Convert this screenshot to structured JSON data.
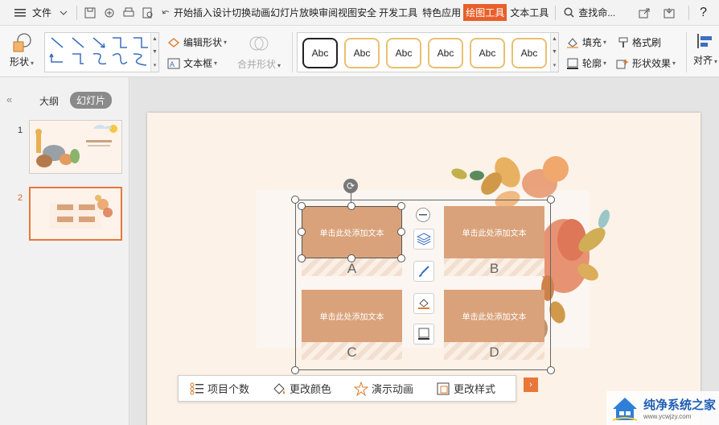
{
  "menubar": {
    "file": "文件",
    "tabs": [
      "开始",
      "插入",
      "设计",
      "切换",
      "动画",
      "幻灯片放映",
      "审阅",
      "视图",
      "安全",
      "开发工具",
      "特色应用",
      "绘图工具",
      "文本工具"
    ],
    "search": "查找命..."
  },
  "ribbon": {
    "shape": "形状",
    "edit_shape": "编辑形状",
    "text_box": "文本框",
    "merge_shape": "合并形状",
    "style_samples": [
      "Abc",
      "Abc",
      "Abc",
      "Abc",
      "Abc",
      "Abc"
    ],
    "fill": "填充",
    "format_painter": "格式刷",
    "outline": "轮廓",
    "shape_effect": "形状效果",
    "align": "对齐"
  },
  "leftpanel": {
    "tab_outline": "大纲",
    "tab_slides": "幻灯片",
    "thumbs": [
      "1",
      "2"
    ]
  },
  "slide": {
    "boxes": [
      {
        "text": "单击此处添加文本",
        "letter": "A"
      },
      {
        "text": "单击此处添加文本",
        "letter": "B"
      },
      {
        "text": "单击此处添加文本",
        "letter": "C"
      },
      {
        "text": "单击此处添加文本",
        "letter": "D"
      }
    ]
  },
  "floatbar": {
    "item_count": "项目个数",
    "change_color": "更改颜色",
    "animation": "演示动画",
    "change_style": "更改样式"
  },
  "watermark": {
    "title": "纯净系统之家",
    "url": "www.ycwjzy.com"
  },
  "colors": {
    "accent": "#e85f2a",
    "box": "#d9a27a",
    "slide_bg": "#fdf2e7"
  }
}
